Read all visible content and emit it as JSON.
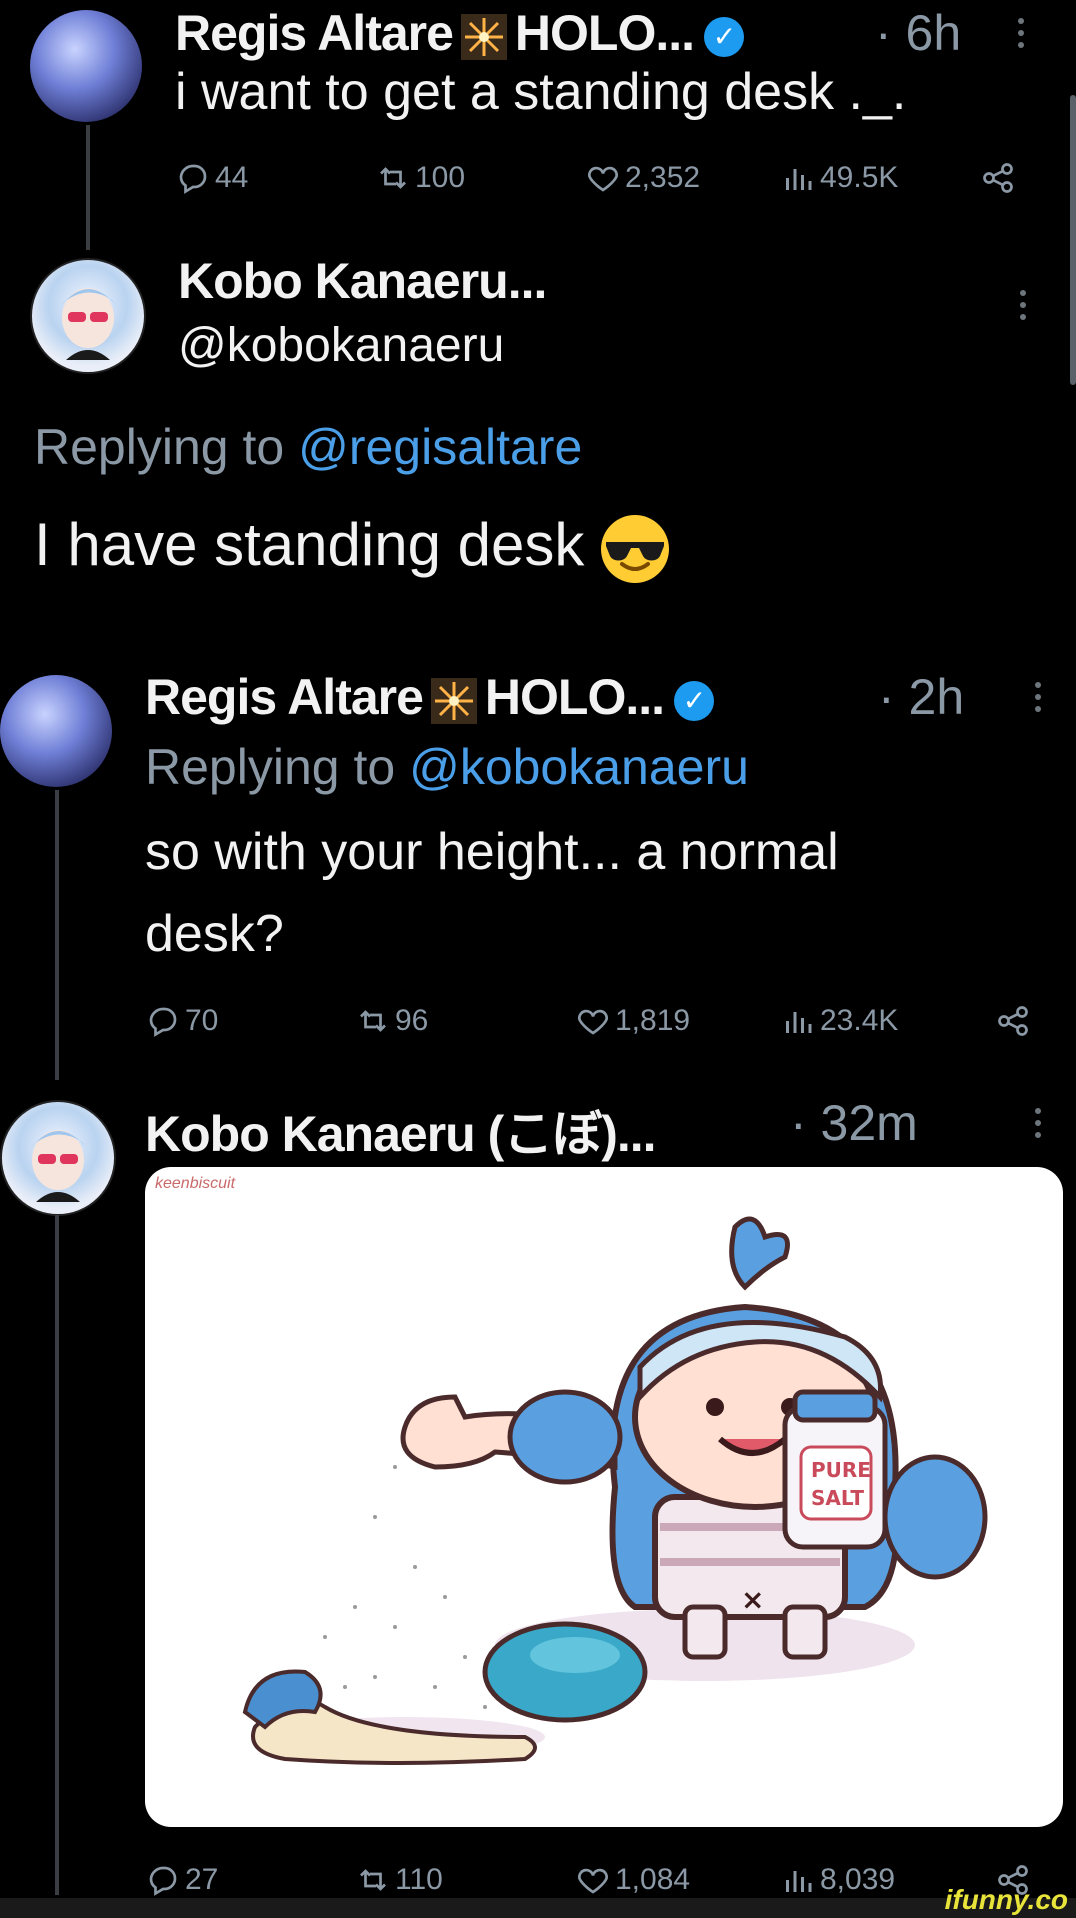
{
  "tweets": [
    {
      "author": "Regis Altare",
      "affiliation": "HOLO...",
      "time": "· 6h",
      "text": "i want to get a standing desk ._.",
      "stats": {
        "replies": "44",
        "retweets": "100",
        "likes": "2,352",
        "views": "49.5K"
      }
    },
    {
      "author": "Kobo Kanaeru...",
      "handle": "@kobokanaeru",
      "replying_prefix": "Replying to",
      "replying_to": "@regisaltare",
      "text": "I have standing desk"
    },
    {
      "author": "Regis Altare",
      "affiliation": "HOLO...",
      "time": "· 2h",
      "replying_prefix": "Replying to",
      "replying_to": "@kobokanaeru",
      "text_line1": "so with your height... a normal",
      "text_line2": "desk?",
      "stats": {
        "replies": "70",
        "retweets": "96",
        "likes": "1,819",
        "views": "23.4K"
      }
    },
    {
      "author": "Kobo Kanaeru (こぼ)...",
      "time": "· 32m",
      "media": {
        "credit": "keenbiscuit",
        "jar_label_line1": "PURE",
        "jar_label_line2": "SALT"
      },
      "stats": {
        "replies": "27",
        "retweets": "110",
        "likes": "1,084",
        "views": "8,039"
      }
    }
  ],
  "watermark": "ifunny.co",
  "colors": {
    "background": "#000000",
    "text": "#e7e9ea",
    "muted": "#8b98a5",
    "link": "#4b9fe8",
    "verified": "#1d9bf0"
  },
  "icons": [
    "avatar",
    "sparkle-icon",
    "verified-badge-icon",
    "more-icon",
    "reply-icon",
    "retweet-icon",
    "like-icon",
    "views-icon",
    "share-icon",
    "sunglasses-emoji-icon"
  ]
}
